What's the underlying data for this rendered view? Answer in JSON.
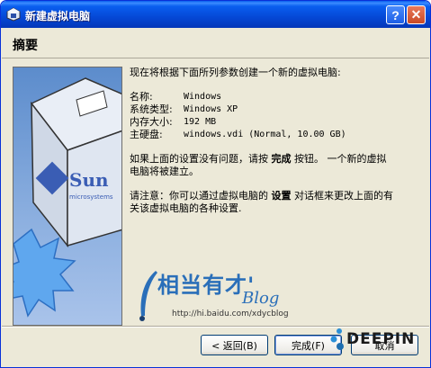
{
  "window": {
    "title": "新建虚拟电脑",
    "help_label": "?",
    "close_label": "✕"
  },
  "header": {
    "title": "摘要"
  },
  "content": {
    "intro": "现在将根据下面所列参数创建一个新的虚拟电脑:",
    "details": [
      {
        "label": "名称:",
        "value": "Windows"
      },
      {
        "label": "系统类型:",
        "value": "Windows XP"
      },
      {
        "label": "内存大小:",
        "value": "192 MB"
      },
      {
        "label": "主硬盘:",
        "value": "windows.vdi (Normal, 10.00 GB)"
      }
    ],
    "para1": {
      "before": "如果上面的设置没有问题，请按",
      "bold": "完成",
      "after": "按钮。 一个新的虚拟",
      "line2": "电脑将被建立。"
    },
    "para2": {
      "before": "请注意：你可以通过虚拟电脑的",
      "bold": "设置",
      "after": "对话框来更改上面的有",
      "line2": "关该虚拟电脑的各种设置."
    }
  },
  "image": {
    "logo_text": "Sun",
    "logo_subtext": "microsystems"
  },
  "watermark": {
    "brand": "相当有才'",
    "blog": "Blog",
    "url": "http://hi.baidu.com/xdycblog"
  },
  "buttons": {
    "back": "< 返回(B)",
    "finish": "完成(F)",
    "cancel": "取消"
  },
  "deepin": {
    "text": "DEEPIN"
  },
  "colors": {
    "title_bar": "#0548d6",
    "dialog_bg": "#ece9d8",
    "accent": "#2a6fb9"
  }
}
